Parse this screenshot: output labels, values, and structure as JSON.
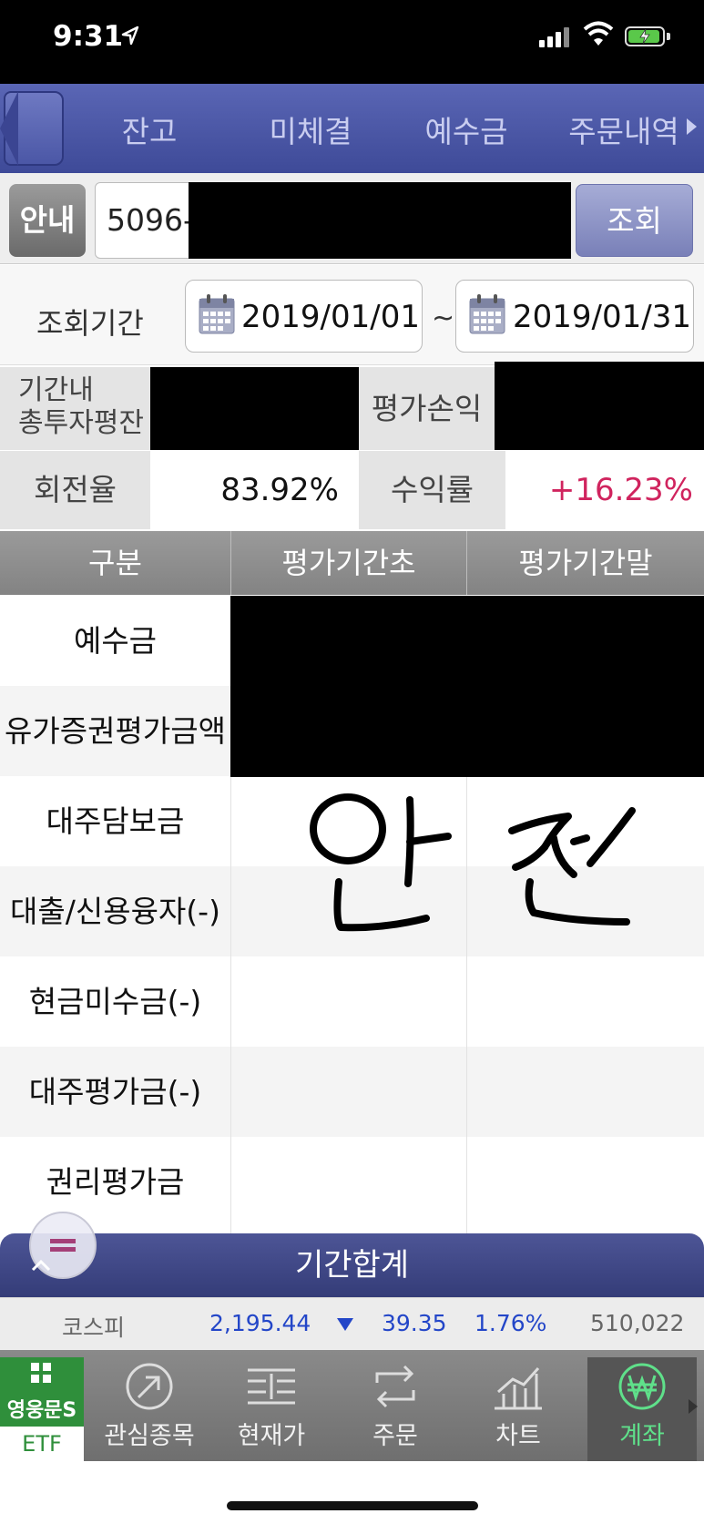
{
  "status_bar": {
    "time": "9:31"
  },
  "tabs": [
    {
      "label": "잔고"
    },
    {
      "label": "미체결"
    },
    {
      "label": "예수금"
    },
    {
      "label": "주문내역"
    }
  ],
  "account": {
    "guide_label": "안내",
    "number_visible": "5096-",
    "query_label": "조회"
  },
  "period": {
    "label": "조회기간",
    "start": "2019/01/01",
    "separator": "~",
    "end": "2019/01/31"
  },
  "summary": {
    "total_invest_label_line1": "기간내",
    "total_invest_label_line2": "총투자평잔",
    "pnl_label": "평가손익",
    "turnover_label": "회전율",
    "turnover_value": "83.92%",
    "return_label": "수익률",
    "return_value": "+16.23%",
    "return_color": "#d0245e"
  },
  "table": {
    "headers": [
      "구분",
      "평가기간초",
      "평가기간말"
    ],
    "rows": [
      {
        "label": "예수금"
      },
      {
        "label": "유가증권평가금액"
      },
      {
        "label": "대주담보금"
      },
      {
        "label": "대출/신용융자(-)"
      },
      {
        "label": "현금미수금(-)"
      },
      {
        "label": "대주평가금(-)"
      },
      {
        "label": "권리평가금"
      }
    ],
    "handwriting": "안전"
  },
  "footer": {
    "period_total_label": "기간합계",
    "index": {
      "name": "코스피",
      "value": "2,195.44",
      "change": "39.35",
      "change_pct": "1.76%",
      "volume": "510,022",
      "up_color": "#2346c8"
    }
  },
  "bottom_nav": {
    "etf_brand": "영웅문S",
    "etf_label": "ETF",
    "items": [
      {
        "label": "관심종목",
        "icon": "star-circle-icon"
      },
      {
        "label": "현재가",
        "icon": "price-list-icon"
      },
      {
        "label": "주문",
        "icon": "order-arrows-icon"
      },
      {
        "label": "차트",
        "icon": "chart-icon"
      },
      {
        "label": "계좌",
        "icon": "won-icon"
      }
    ]
  }
}
